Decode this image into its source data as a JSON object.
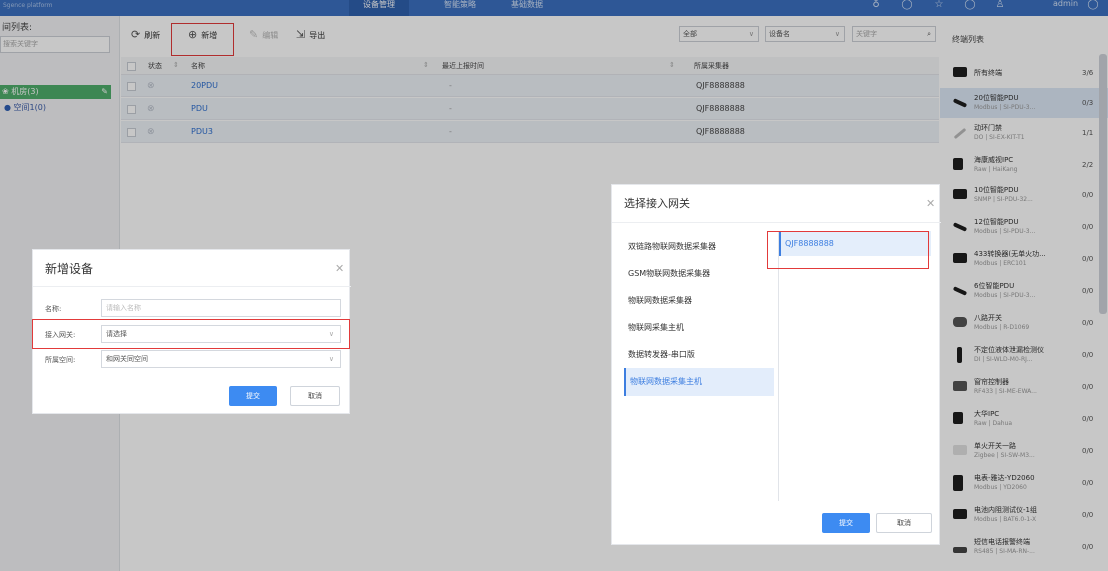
{
  "topbar": {
    "brand": "Sgence platform",
    "tabs": [
      {
        "label": "设备管理",
        "active": true
      },
      {
        "label": "智能策略",
        "active": false
      },
      {
        "label": "基础数据",
        "active": false
      }
    ],
    "user": "admin"
  },
  "space_panel": {
    "title": "间列表:",
    "search_placeholder": "搜索关键字",
    "tree_root": "机房(3)",
    "tree_child": "空间1(0)"
  },
  "toolbar": {
    "refresh": "刷新",
    "add": "新增",
    "edit": "编辑",
    "export": "导出"
  },
  "filters": {
    "scope": "全部",
    "field": "设备名",
    "keyword_placeholder": "关键字"
  },
  "table": {
    "headers": [
      "状态",
      "名称",
      "最近上报时间",
      "所属采集器"
    ],
    "rows": [
      {
        "name": "20PDU",
        "time": "-",
        "gateway": "QJF8888888"
      },
      {
        "name": "PDU",
        "time": "-",
        "gateway": "QJF8888888"
      },
      {
        "name": "PDU3",
        "time": "-",
        "gateway": "QJF8888888"
      }
    ]
  },
  "terminal_list": {
    "title": "终端列表",
    "items": [
      {
        "name": "所有终端",
        "sub": "",
        "count": "3/6",
        "selected": false
      },
      {
        "name": "20位智能PDU",
        "sub": "Modbus | SI-PDU-3...",
        "count": "0/3",
        "selected": true
      },
      {
        "name": "动环门禁",
        "sub": "DO | SI-EX-KIT-T1",
        "count": "1/1",
        "selected": false
      },
      {
        "name": "海康威视IPC",
        "sub": "Raw | HaiKang",
        "count": "2/2",
        "selected": false
      },
      {
        "name": "10位智能PDU",
        "sub": "SNMP | SI-PDU-32...",
        "count": "0/0",
        "selected": false
      },
      {
        "name": "12位智能PDU",
        "sub": "Modbus | SI-PDU-3...",
        "count": "0/0",
        "selected": false
      },
      {
        "name": "433转换器(无单火功...",
        "sub": "Modbus | ERC101",
        "count": "0/0",
        "selected": false
      },
      {
        "name": "6位智能PDU",
        "sub": "Modbus | SI-PDU-3...",
        "count": "0/0",
        "selected": false
      },
      {
        "name": "八路开关",
        "sub": "Modbus | R-D1069",
        "count": "0/0",
        "selected": false
      },
      {
        "name": "不定位液体泄漏检测仪",
        "sub": "DI | SI-WLD-M0-RJ...",
        "count": "0/0",
        "selected": false
      },
      {
        "name": "窗帘控制器",
        "sub": "RF433 | SI-ME-EWA...",
        "count": "0/0",
        "selected": false
      },
      {
        "name": "大华IPC",
        "sub": "Raw | Dahua",
        "count": "0/0",
        "selected": false
      },
      {
        "name": "单火开关一路",
        "sub": "Zigbee | SI-SW-M3...",
        "count": "0/0",
        "selected": false
      },
      {
        "name": "电表-雅达-YD2060",
        "sub": "Modbus | YD2060",
        "count": "0/0",
        "selected": false
      },
      {
        "name": "电池内阻测试仪-1组",
        "sub": "Modbus | BAT6.0-1-X",
        "count": "0/0",
        "selected": false
      },
      {
        "name": "短信电话报警终端",
        "sub": "RS485 | SI-MA-RN-...",
        "count": "0/0",
        "selected": false
      }
    ]
  },
  "add_device_dialog": {
    "title": "新增设备",
    "name_label": "名称:",
    "name_placeholder": "请输入名称",
    "gateway_label": "接入网关:",
    "gateway_value": "请选择",
    "space_label": "所属空间:",
    "space_value": "和网关同空间",
    "submit": "提交",
    "cancel": "取消"
  },
  "gateway_dialog": {
    "title": "选择接入网关",
    "categories": [
      {
        "label": "双链路物联网数据采集器",
        "selected": false
      },
      {
        "label": "GSM物联网数据采集器",
        "selected": false
      },
      {
        "label": "物联网数据采集器",
        "selected": false
      },
      {
        "label": "物联网采集主机",
        "selected": false
      },
      {
        "label": "数据转发器-串口版",
        "selected": false
      },
      {
        "label": "物联网数据采集主机",
        "selected": true
      }
    ],
    "gateways": [
      "QJF8888888"
    ],
    "submit": "提交",
    "cancel": "取消"
  }
}
